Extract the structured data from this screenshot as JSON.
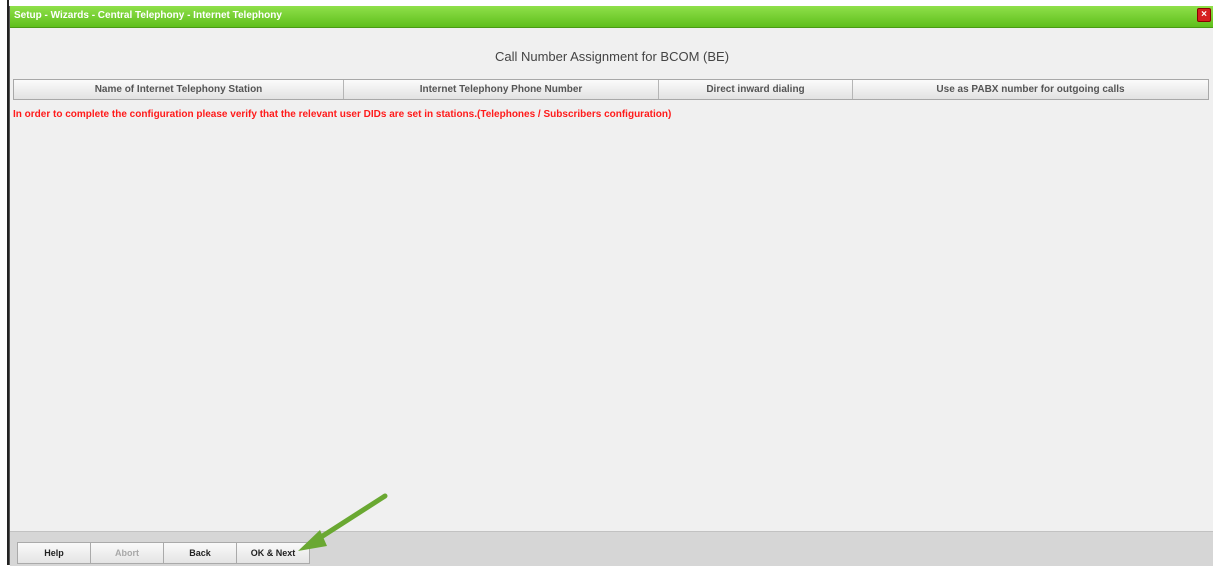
{
  "window": {
    "title": "Setup - Wizards - Central Telephony - Internet Telephony",
    "close_label": "×"
  },
  "page": {
    "heading": "Call Number Assignment for BCOM (BE)"
  },
  "table": {
    "columns": [
      "Name of Internet Telephony Station",
      "Internet Telephony Phone Number",
      "Direct inward dialing",
      "Use as PABX number for outgoing calls"
    ]
  },
  "message": "In order to complete the configuration please verify that the relevant user DIDs are set in stations.(Telephones / Subscribers configuration)",
  "footer": {
    "help_label": "Help",
    "abort_label": "Abort",
    "back_label": "Back",
    "ok_next_label": "OK & Next"
  },
  "colors": {
    "title_bar": "#6fcf2a",
    "message_text": "#ff1a1a",
    "annotation_arrow": "#6aa832"
  },
  "annotation": {
    "icon": "pointer-arrow-icon",
    "target": "ok-next-button"
  }
}
